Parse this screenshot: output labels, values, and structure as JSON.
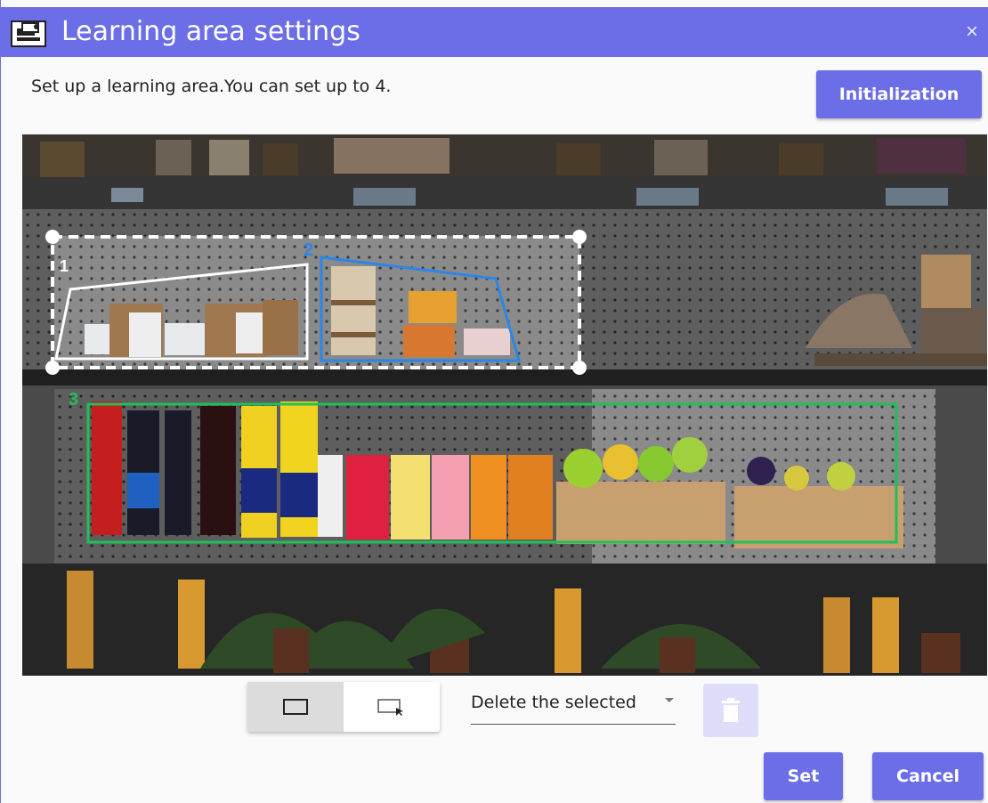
{
  "window": {
    "title": "Learning area settings",
    "close_glyph": "×",
    "accent": "#6b6ee6"
  },
  "instruction": "Set up a learning area.You can set up to 4.",
  "buttons": {
    "initialization": "Initialization",
    "set": "Set",
    "cancel": "Cancel"
  },
  "areas": [
    {
      "label": "1",
      "color": "#ffffff",
      "selected": true
    },
    {
      "label": "2",
      "color": "#2a86e8",
      "selected": false
    },
    {
      "label": "3",
      "color": "#1fbf5a",
      "selected": false
    }
  ],
  "toolbar": {
    "tools": [
      {
        "icon": "rectangle-icon",
        "active": true
      },
      {
        "icon": "polygon-select-icon",
        "active": false
      }
    ],
    "delete_select_value": "Delete the selected",
    "trash_icon": "trash-icon"
  }
}
